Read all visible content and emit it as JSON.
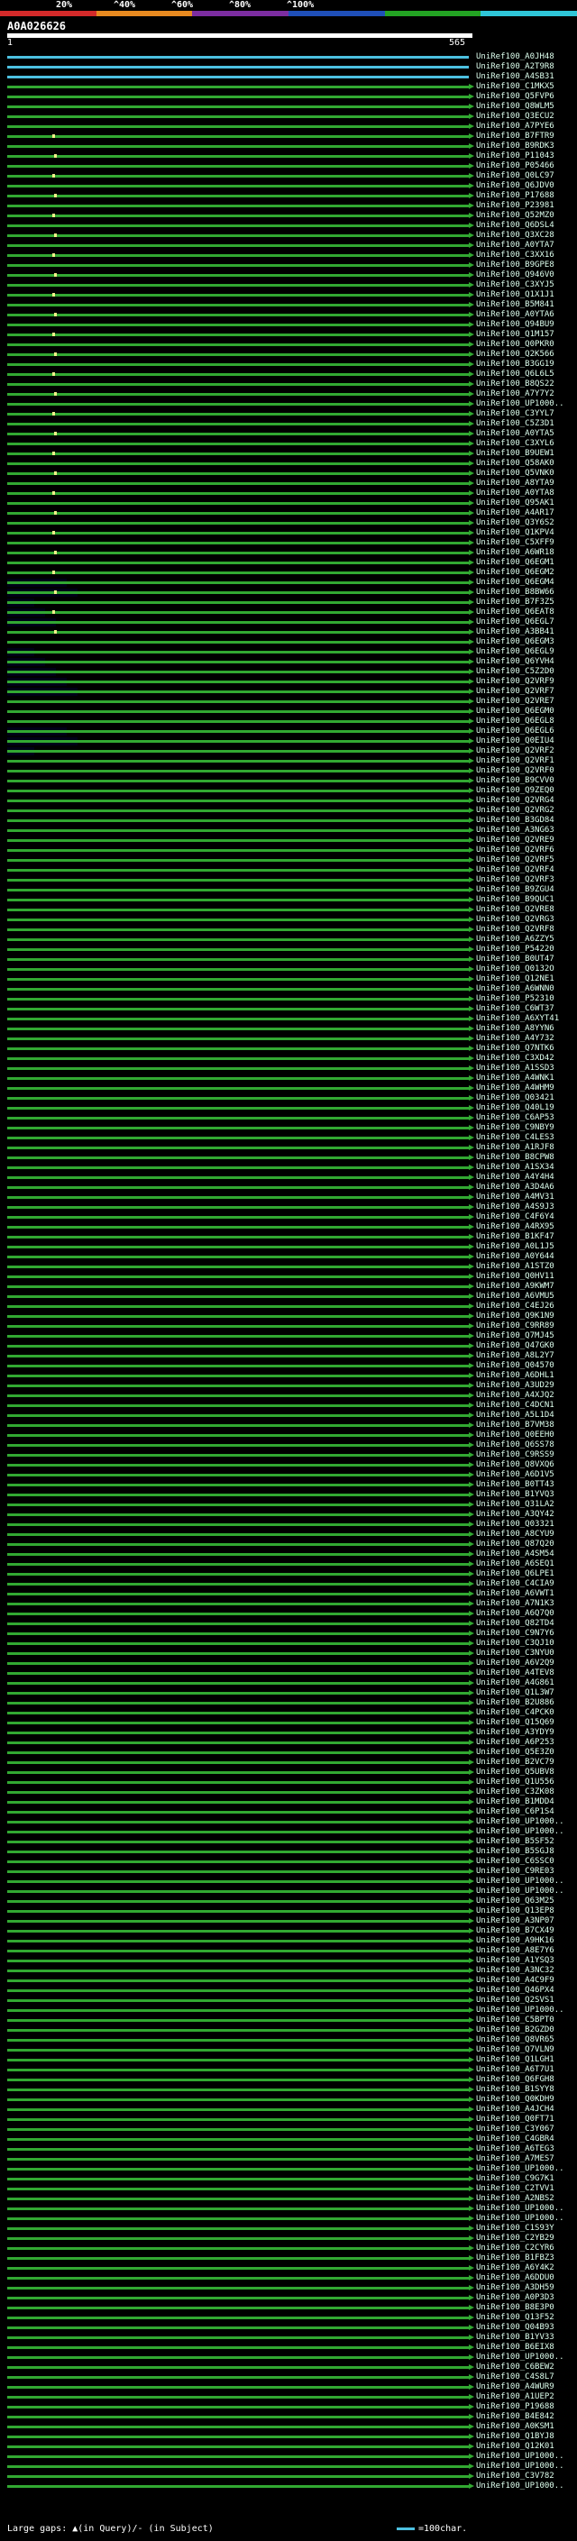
{
  "scale": {
    "labels": [
      "20%",
      "^40%",
      "^60%",
      "^80%",
      "^100%"
    ],
    "colors": [
      "#d42a2a",
      "#e88a20",
      "#7c2da0",
      "#1f4fb8",
      "#23a323",
      "#2fc6d8"
    ]
  },
  "query": {
    "id": "A0A026626",
    "start": "1",
    "end": "565"
  },
  "colors": {
    "subject_bar": "#32a832",
    "full_bar": "#4cc0e0",
    "mark": "#f4f08a",
    "gap": "#000018"
  },
  "hits": [
    "UniRef100_A0JH48",
    "UniRef100_A2T9R8",
    "UniRef100_A4SB31",
    "UniRef100_C1MKX5",
    "UniRef100_Q5FVP6",
    "UniRef100_Q8WLM5",
    "UniRef100_Q3ECU2",
    "UniRef100_A7PYE6",
    "UniRef100_B7FTR9",
    "UniRef100_B9RDK3",
    "UniRef100_P11043",
    "UniRef100_P05466",
    "UniRef100_Q0LC97",
    "UniRef100_Q6JDV0",
    "UniRef100_P17688",
    "UniRef100_P23981",
    "UniRef100_Q52MZ0",
    "UniRef100_Q6DSL4",
    "UniRef100_Q3XC28",
    "UniRef100_A0YTA7",
    "UniRef100_C3XX16",
    "UniRef100_B9GPE8",
    "UniRef100_Q946V0",
    "UniRef100_C3XYJ5",
    "UniRef100_Q1X1J1",
    "UniRef100_B5M841",
    "UniRef100_A0YTA6",
    "UniRef100_Q94BU9",
    "UniRef100_Q1M157",
    "UniRef100_Q0PKR0",
    "UniRef100_Q2K566",
    "UniRef100_B3GG19",
    "UniRef100_Q6L6L5",
    "UniRef100_B8QS22",
    "UniRef100_A7Y7Y2",
    "UniRef100_UP1000..",
    "UniRef100_C3YYL7",
    "UniRef100_C5Z3D1",
    "UniRef100_A0YTA5",
    "UniRef100_C3XYL6",
    "UniRef100_B9UEW1",
    "UniRef100_Q58AK0",
    "UniRef100_Q5VNK0",
    "UniRef100_A8YTA9",
    "UniRef100_A0YTA8",
    "UniRef100_Q95AK1",
    "UniRef100_A4AR17",
    "UniRef100_Q3Y6S2",
    "UniRef100_Q1KPV4",
    "UniRef100_C5XFF9",
    "UniRef100_A6WR18",
    "UniRef100_Q6EGM1",
    "UniRef100_Q6EGM2",
    "UniRef100_Q6EGM4",
    "UniRef100_B8BW66",
    "UniRef100_B7F3Z5",
    "UniRef100_Q6EAT8",
    "UniRef100_Q6EGL7",
    "UniRef100_A3BB41",
    "UniRef100_Q6EGM3",
    "UniRef100_Q6EGL9",
    "UniRef100_Q6YVH4",
    "UniRef100_C5Z2D0",
    "UniRef100_Q2VRF9",
    "UniRef100_Q2VRF7",
    "UniRef100_Q2VRE7",
    "UniRef100_Q6EGM0",
    "UniRef100_Q6EGL8",
    "UniRef100_Q6EGL6",
    "UniRef100_Q0EIU4",
    "UniRef100_Q2VRF2",
    "UniRef100_Q2VRF1",
    "UniRef100_Q2VRF0",
    "UniRef100_B9CVV0",
    "UniRef100_Q9ZEQ0",
    "UniRef100_Q2VRG4",
    "UniRef100_Q2VRG2",
    "UniRef100_B3GD84",
    "UniRef100_A3NG63",
    "UniRef100_Q2VRE9",
    "UniRef100_Q2VRF6",
    "UniRef100_Q2VRF5",
    "UniRef100_Q2VRF4",
    "UniRef100_Q2VRF3",
    "UniRef100_B9ZGU4",
    "UniRef100_B9QUC1",
    "UniRef100_Q2VRE8",
    "UniRef100_Q2VRG3",
    "UniRef100_Q2VRF8",
    "UniRef100_A6ZZY5",
    "UniRef100_P54220",
    "UniRef100_B0UT47",
    "UniRef100_Q0132O",
    "UniRef100_Q12NE1",
    "UniRef100_A6WNN0",
    "UniRef100_P52310",
    "UniRef100_C6WT37",
    "UniRef100_A6XYT41",
    "UniRef100_A8YYN6",
    "UniRef100_A4Y732",
    "UniRef100_Q7NTK6",
    "UniRef100_C3XD42",
    "UniRef100_A1SSD3",
    "UniRef100_A4WNK1",
    "UniRef100_A4WHM9",
    "UniRef100_Q03421",
    "UniRef100_Q40L19",
    "UniRef100_C6AP53",
    "UniRef100_C9NBY9",
    "UniRef100_C4LES3",
    "UniRef100_A1RJF8",
    "UniRef100_B8CPW8",
    "UniRef100_A1SX34",
    "UniRef100_A4Y4H4",
    "UniRef100_A3D4A6",
    "UniRef100_A4MV31",
    "UniRef100_A4S9J3",
    "UniRef100_C4F6Y4",
    "UniRef100_A4RX95",
    "UniRef100_B1KF47",
    "UniRef100_A0L1J5",
    "UniRef100_A0Y644",
    "UniRef100_A1STZ0",
    "UniRef100_Q0HV11",
    "UniRef100_A9KWM7",
    "UniRef100_A6VMU5",
    "UniRef100_C4EJ26",
    "UniRef100_Q9K1N9",
    "UniRef100_C9RR89",
    "UniRef100_Q7MJ45",
    "UniRef100_Q47GK0",
    "UniRef100_A8L2Y7",
    "UniRef100_Q04570",
    "UniRef100_A6DHL1",
    "UniRef100_A3UD29",
    "UniRef100_A4XJQ2",
    "UniRef100_C4DCN1",
    "UniRef100_A5L1D4",
    "UniRef100_B7VM38",
    "UniRef100_Q0EEH0",
    "UniRef100_Q6SS78",
    "UniRef100_C9RSS9",
    "UniRef100_Q8VXQ6",
    "UniRef100_A6D1V5",
    "UniRef100_B0TT43",
    "UniRef100_B1YVQ3",
    "UniRef100_Q31LA2",
    "UniRef100_A3QY42",
    "UniRef100_Q03321",
    "UniRef100_A8CYU9",
    "UniRef100_Q87Q20",
    "UniRef100_A4SM54",
    "UniRef100_A6SEQ1",
    "UniRef100_Q6LPE1",
    "UniRef100_C4CIA9",
    "UniRef100_A6VWT1",
    "UniRef100_A7N1K3",
    "UniRef100_A6Q7Q0",
    "UniRef100_Q82TD4",
    "UniRef100_C9N7Y6",
    "UniRef100_C3QJ10",
    "UniRef100_C3NYU0",
    "UniRef100_A6V2Q9",
    "UniRef100_A4TEV8",
    "UniRef100_A4G861",
    "UniRef100_Q1L3W7",
    "UniRef100_B2U886",
    "UniRef100_C4PCK0",
    "UniRef100_Q15Q69",
    "UniRef100_A3YDY9",
    "UniRef100_A6P253",
    "UniRef100_Q5E3Z0",
    "UniRef100_B2VC79",
    "UniRef100_Q5UBV8",
    "UniRef100_Q1U556",
    "UniRef100_C3ZK08",
    "UniRef100_B1MDD4",
    "UniRef100_C6P1S4",
    "UniRef100_UP1000..",
    "UniRef100_UP1000..",
    "UniRef100_B5SF52",
    "UniRef100_B5SGJ8",
    "UniRef100_C6SSC0",
    "UniRef100_C9RE03",
    "UniRef100_UP1000..",
    "UniRef100_UP1000..",
    "UniRef100_Q63M25",
    "UniRef100_Q13EP8",
    "UniRef100_A3NP07",
    "UniRef100_B7CX49",
    "UniRef100_A9HK16",
    "UniRef100_A8E7Y6",
    "UniRef100_A1YSQ3",
    "UniRef100_A3NC32",
    "UniRef100_A4C9F9",
    "UniRef100_Q46PX4",
    "UniRef100_Q2SVS1",
    "UniRef100_UP1000..",
    "UniRef100_C5BPT0",
    "UniRef100_B2GZD0",
    "UniRef100_Q8VR65",
    "UniRef100_Q7VLN9",
    "UniRef100_Q1LGH1",
    "UniRef100_A6T7U1",
    "UniRef100_Q6FGH8",
    "UniRef100_B1SYY8",
    "UniRef100_Q0KDH9",
    "UniRef100_A4JCH4",
    "UniRef100_Q0FT71",
    "UniRef100_C3Y067",
    "UniRef100_C4GBR4",
    "UniRef100_A6TEG3",
    "UniRef100_A7MES7",
    "UniRef100_UP1000..",
    "UniRef100_C9G7K1",
    "UniRef100_C2TVV1",
    "UniRef100_A2NBS2",
    "UniRef100_UP1000..",
    "UniRef100_UP1000..",
    "UniRef100_C1S93Y",
    "UniRef100_C2YB29",
    "UniRef100_C2CYR6",
    "UniRef100_B1FBZ3",
    "UniRef100_A6Y4K2",
    "UniRef100_A6DDU0",
    "UniRef100_A3DH59",
    "UniRef100_A0P3D3",
    "UniRef100_B8E3P0",
    "UniRef100_Q13F52",
    "UniRef100_Q04B93",
    "UniRef100_B1YV33",
    "UniRef100_B6EIX8",
    "UniRef100_UP1000..",
    "UniRef100_C6BEW2",
    "UniRef100_C4S8L7",
    "UniRef100_A4WUR9",
    "UniRef100_A1UEP2",
    "UniRef100_P19688",
    "UniRef100_B4E842",
    "UniRef100_A0KSM1",
    "UniRef100_Q1BYJ8",
    "UniRef100_Q12K01",
    "UniRef100_UP1000..",
    "UniRef100_UP1000..",
    "UniRef100_C3V782",
    "UniRef100_UP1000.."
  ],
  "footer": {
    "text": "Large gaps: ▲(in Query)/- (in Subject)",
    "legend": "=100char."
  }
}
